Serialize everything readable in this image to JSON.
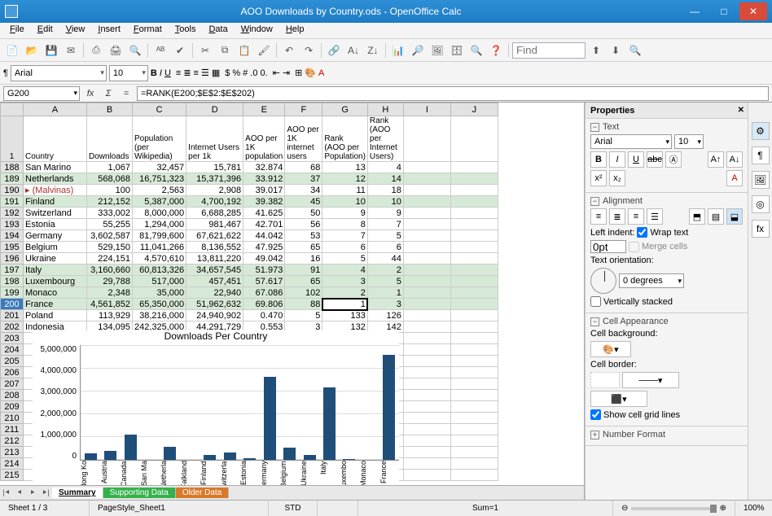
{
  "window": {
    "title": "AOO Downloads by Country.ods - OpenOffice Calc"
  },
  "menu": [
    "File",
    "Edit",
    "View",
    "Insert",
    "Format",
    "Tools",
    "Data",
    "Window",
    "Help"
  ],
  "find_placeholder": "Find",
  "font": {
    "name": "Arial",
    "size": "10"
  },
  "cellref": "G200",
  "formula": "=RANK(E200;$E$2:$E$202)",
  "columns": [
    "A",
    "B",
    "C",
    "D",
    "E",
    "F",
    "G",
    "H",
    "I",
    "J"
  ],
  "headers": {
    "row": "1",
    "A": "Country",
    "B": "Downloads",
    "C": "Population (per Wikipedia)",
    "D": "Internet Users per 1k",
    "E": "AOO per 1K population",
    "F": "AOO per 1K internet users",
    "G": "Rank (AOO per Population)",
    "H": "Rank (AOO per Internet Users)"
  },
  "rows": [
    {
      "n": "188",
      "g": false,
      "A": "San Marino",
      "B": "1,067",
      "C": "32,457",
      "D": "15,781",
      "E": "32.874",
      "F": "68",
      "G": "13",
      "H": "4"
    },
    {
      "n": "189",
      "g": true,
      "A": "Netherlands",
      "B": "568,068",
      "C": "16,751,323",
      "D": "15,371,396",
      "E": "33.912",
      "F": "37",
      "G": "12",
      "H": "14"
    },
    {
      "n": "190",
      "g": false,
      "A": "(Malvinas)",
      "B": "100",
      "C": "2,563",
      "D": "2,908",
      "E": "39.017",
      "F": "34",
      "G": "11",
      "H": "18",
      "mark": true
    },
    {
      "n": "191",
      "g": true,
      "A": "Finland",
      "B": "212,152",
      "C": "5,387,000",
      "D": "4,700,192",
      "E": "39.382",
      "F": "45",
      "G": "10",
      "H": "10"
    },
    {
      "n": "192",
      "g": false,
      "A": "Switzerland",
      "B": "333,002",
      "C": "8,000,000",
      "D": "6,688,285",
      "E": "41.625",
      "F": "50",
      "G": "9",
      "H": "9"
    },
    {
      "n": "193",
      "g": false,
      "A": "Estonia",
      "B": "55,255",
      "C": "1,294,000",
      "D": "981,467",
      "E": "42.701",
      "F": "56",
      "G": "8",
      "H": "7"
    },
    {
      "n": "194",
      "g": false,
      "A": "Germany",
      "B": "3,602,587",
      "C": "81,799,600",
      "D": "67,621,622",
      "E": "44.042",
      "F": "53",
      "G": "7",
      "H": "5"
    },
    {
      "n": "195",
      "g": false,
      "A": "Belgium",
      "B": "529,150",
      "C": "11,041,266",
      "D": "8,136,552",
      "E": "47.925",
      "F": "65",
      "G": "6",
      "H": "6"
    },
    {
      "n": "196",
      "g": false,
      "A": "Ukraine",
      "B": "224,151",
      "C": "4,570,610",
      "D": "13,811,220",
      "E": "49.042",
      "F": "16",
      "G": "5",
      "H": "44"
    },
    {
      "n": "197",
      "g": true,
      "A": "Italy",
      "B": "3,160,660",
      "C": "60,813,326",
      "D": "34,657,545",
      "E": "51.973",
      "F": "91",
      "G": "4",
      "H": "2"
    },
    {
      "n": "198",
      "g": true,
      "A": "Luxembourg",
      "B": "29,788",
      "C": "517,000",
      "D": "457,451",
      "E": "57.617",
      "F": "65",
      "G": "3",
      "H": "5"
    },
    {
      "n": "199",
      "g": true,
      "A": "Monaco",
      "B": "2,348",
      "C": "35,000",
      "D": "22,940",
      "E": "67.086",
      "F": "102",
      "G": "2",
      "H": "1"
    },
    {
      "n": "200",
      "g": true,
      "A": "France",
      "B": "4,561,852",
      "C": "65,350,000",
      "D": "51,962,632",
      "E": "69.806",
      "F": "88",
      "G": "1",
      "H": "3",
      "active": true,
      "sel": "G"
    },
    {
      "n": "201",
      "g": false,
      "A": "Poland",
      "B": "113,929",
      "C": "38,216,000",
      "D": "24,940,902",
      "E": "0.470",
      "F": "5",
      "G": "133",
      "H": "126"
    },
    {
      "n": "202",
      "g": false,
      "A": "Indonesia",
      "B": "134,095",
      "C": "242,325,000",
      "D": "44,291,729",
      "E": "0.553",
      "F": "3",
      "G": "132",
      "H": "142"
    }
  ],
  "extrarows": [
    "203",
    "204",
    "205",
    "206",
    "207",
    "208",
    "209",
    "210",
    "211",
    "212",
    "213",
    "214",
    "215"
  ],
  "chart_data": {
    "type": "bar",
    "title": "Downloads Per Country",
    "categories": [
      "Hong Ko",
      "Austria",
      "Canada",
      "San Ma",
      "Netherla",
      "Falkland",
      "Finland",
      "Switzerla",
      "Estonia",
      "Germany",
      "Belgium",
      "Ukraine",
      "Italy",
      "Luxembo",
      "Monaco",
      "France"
    ],
    "values": [
      300000,
      400000,
      1100000,
      1000,
      570000,
      100,
      210000,
      330000,
      55000,
      3600000,
      530000,
      220000,
      3160000,
      30000,
      2000,
      4560000
    ],
    "ylim": [
      0,
      5000000
    ],
    "yticks": [
      "5,000,000",
      "4,000,000",
      "3,000,000",
      "2,000,000",
      "1,000,000",
      "0"
    ]
  },
  "tabs": [
    {
      "label": "Summary",
      "style": "active"
    },
    {
      "label": "Supporting Data",
      "style": "green"
    },
    {
      "label": "Older Data",
      "style": "orange"
    }
  ],
  "status": {
    "sheets": "Sheet 1 / 3",
    "style": "PageStyle_Sheet1",
    "mode": "STD",
    "sum": "Sum=1",
    "zoom": "100%"
  },
  "props": {
    "title": "Properties",
    "text_sec": "Text",
    "font": "Arial",
    "size": "10",
    "align_sec": "Alignment",
    "leftindent": "Left indent:",
    "indent_val": "0pt",
    "wrap": "Wrap text",
    "merge": "Merge cells",
    "orient": "Text orientation:",
    "degrees": "0 degrees",
    "vstack": "Vertically stacked",
    "cellapp": "Cell Appearance",
    "cellbg": "Cell background:",
    "cellbd": "Cell border:",
    "gridlines": "Show cell grid lines",
    "numfmt": "Number Format"
  }
}
